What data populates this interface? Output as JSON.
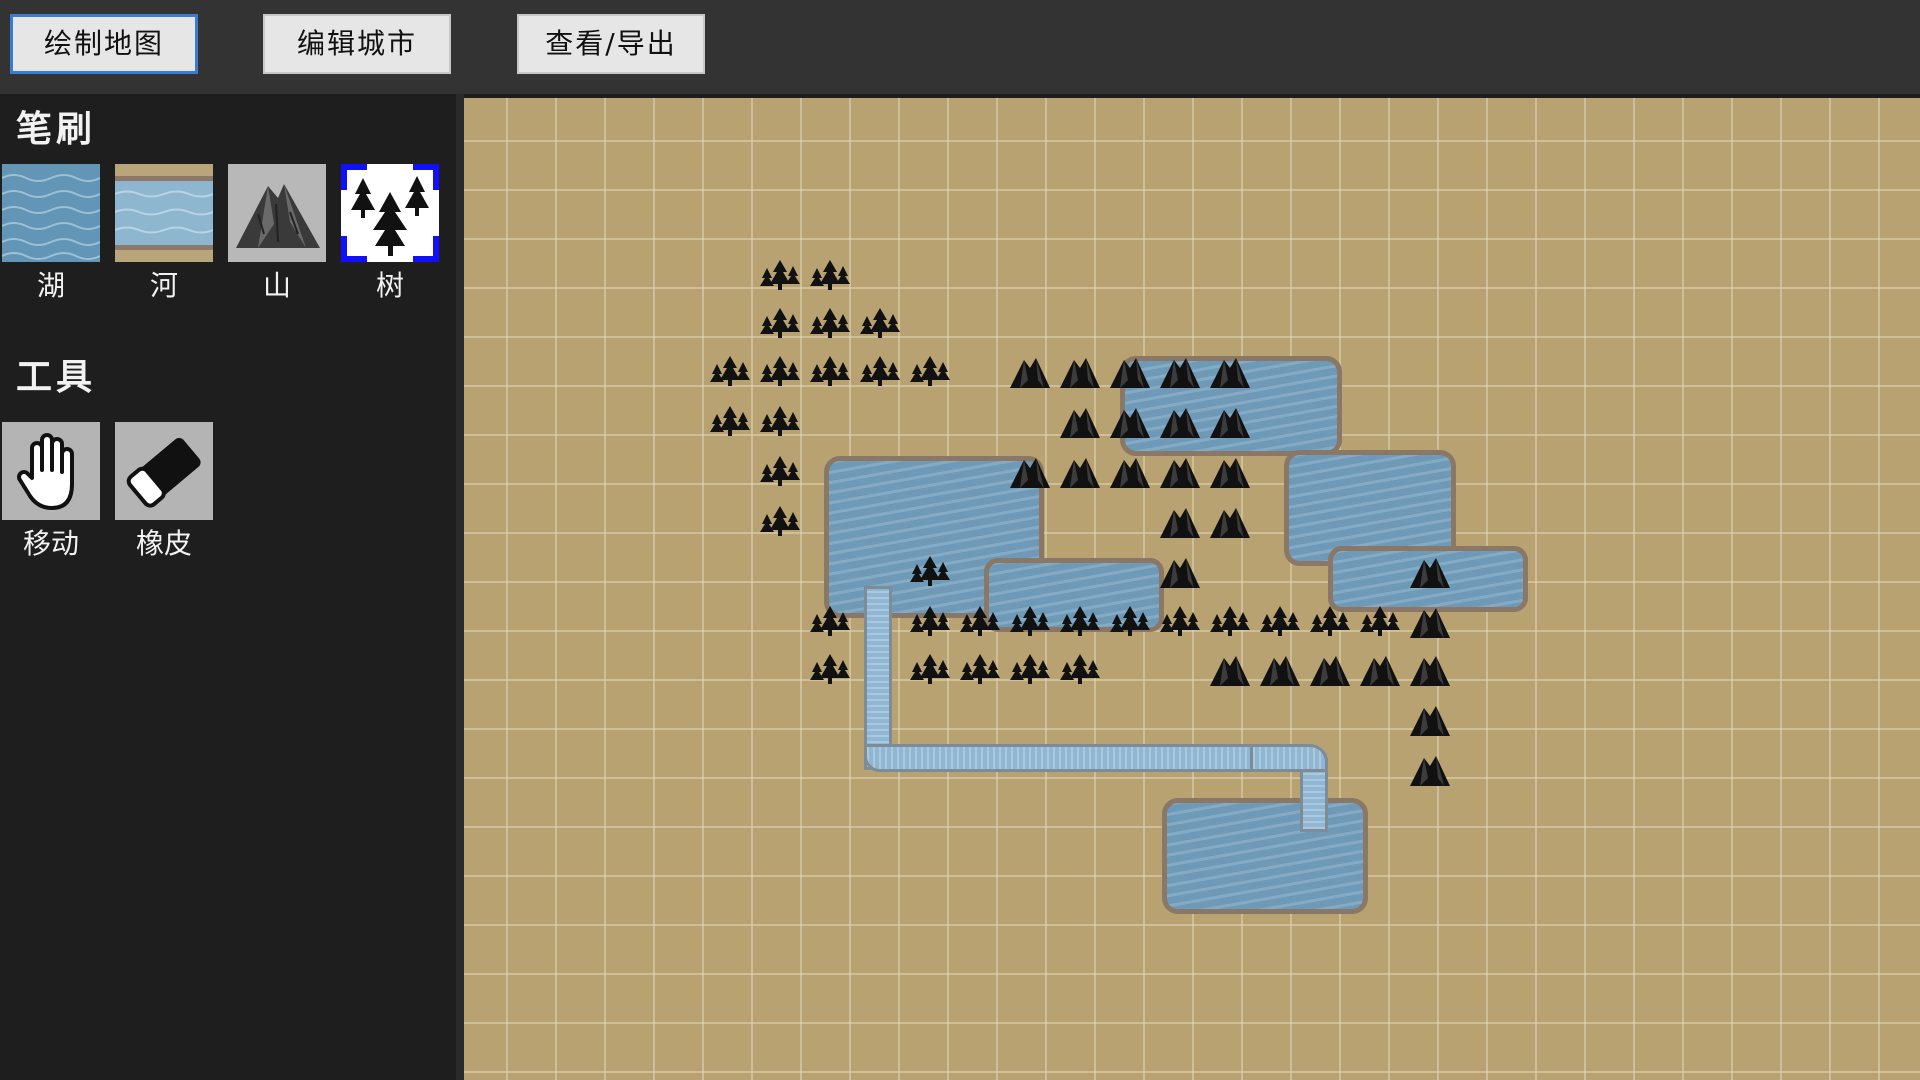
{
  "topbar": {
    "tabs": [
      {
        "label": "绘制地图",
        "active": true
      },
      {
        "label": "编辑城市",
        "active": false
      },
      {
        "label": "查看/导出",
        "active": false
      }
    ]
  },
  "sidebar": {
    "brush_title": "笔刷",
    "brushes": [
      {
        "label": "湖",
        "icon": "lake-icon"
      },
      {
        "label": "河",
        "icon": "river-icon"
      },
      {
        "label": "山",
        "icon": "mountain-icon"
      },
      {
        "label": "树",
        "icon": "tree-icon",
        "selected": true
      }
    ],
    "tools_title": "工具",
    "tools": [
      {
        "label": "移动",
        "icon": "hand-icon"
      },
      {
        "label": "橡皮",
        "icon": "eraser-icon"
      }
    ]
  },
  "colors": {
    "selected_border": "#1010ff",
    "active_tab_border": "#3a7bd5",
    "sand": "#b8a271",
    "water": "#6e9ab8"
  }
}
